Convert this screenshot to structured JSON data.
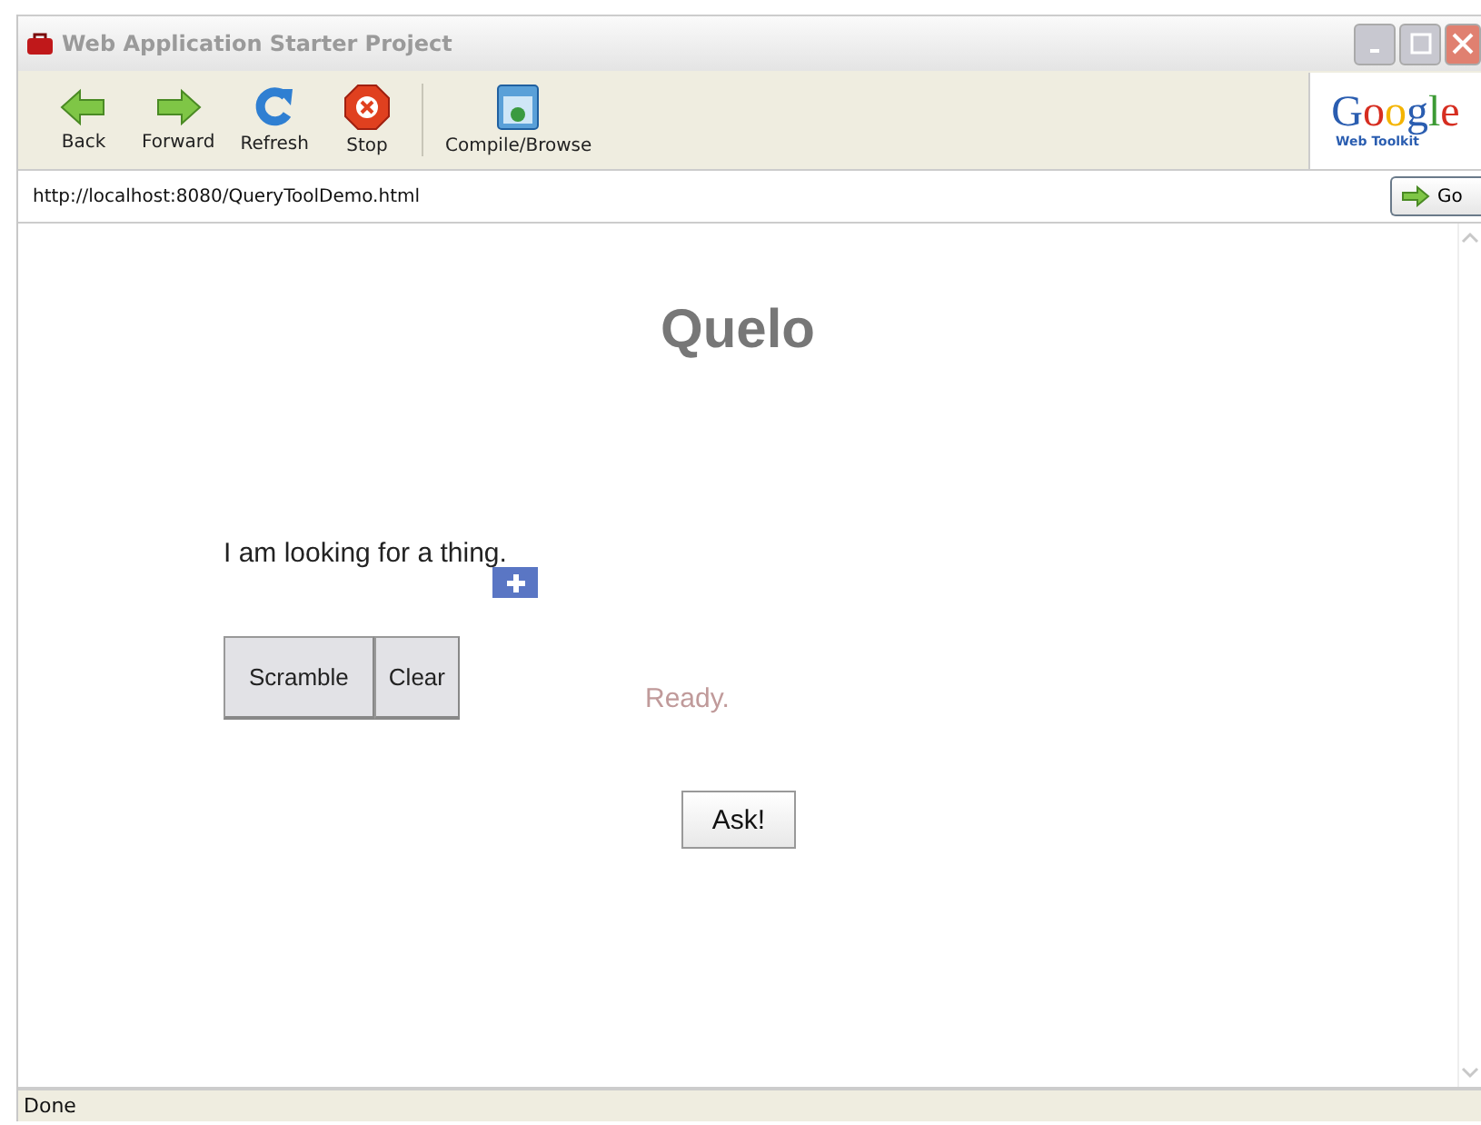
{
  "window": {
    "title": "Web Application Starter Project"
  },
  "toolbar": [
    {
      "label": "Back",
      "kind": "back"
    },
    {
      "label": "Forward",
      "kind": "forward"
    },
    {
      "label": "Refresh",
      "kind": "refresh"
    },
    {
      "label": "Stop",
      "kind": "stop"
    },
    {
      "label": "Compile/Browse",
      "kind": "compile"
    }
  ],
  "logo": {
    "name": "Google",
    "subtitle": "Web Toolkit"
  },
  "address": {
    "value": "http://localhost:8080/QueryToolDemo.html",
    "go": "Go"
  },
  "page": {
    "heading": "Quelo",
    "sentence": "I am looking for a thing.",
    "buttons": [
      "Scramble",
      "Clear"
    ],
    "status": "Ready.",
    "ask": "Ask!"
  },
  "status_bar": "Done"
}
